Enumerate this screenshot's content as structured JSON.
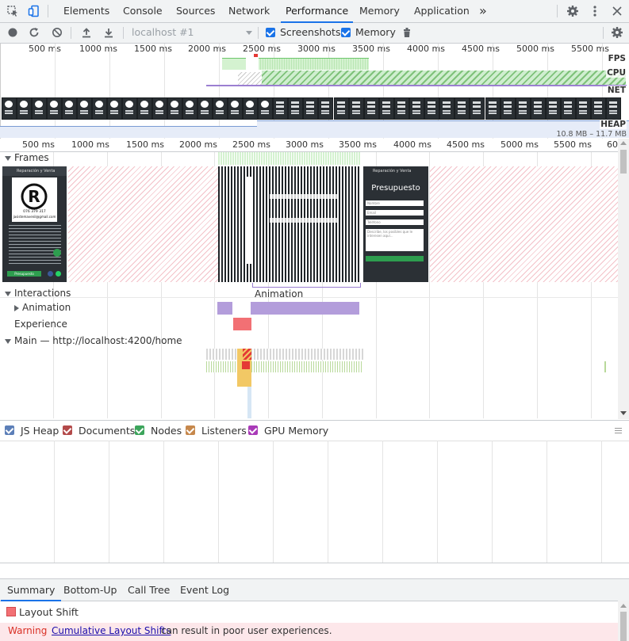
{
  "tabs": [
    {
      "label": "Elements"
    },
    {
      "label": "Console"
    },
    {
      "label": "Sources"
    },
    {
      "label": "Network"
    },
    {
      "label": "Performance"
    },
    {
      "label": "Memory"
    },
    {
      "label": "Application"
    }
  ],
  "more_tabs_glyph": "»",
  "toolbar": {
    "target": "localhost #1",
    "screenshots_label": "Screenshots",
    "memory_label": "Memory"
  },
  "overview": {
    "ticks": [
      "500 ms",
      "1000 ms",
      "1500 ms",
      "2000 ms",
      "2500 ms",
      "3000 ms",
      "3500 ms",
      "4000 ms",
      "4500 ms",
      "5000 ms",
      "5500 ms"
    ],
    "tracks": {
      "fps": "FPS",
      "cpu": "CPU",
      "net": "NET",
      "heap": "HEAP"
    },
    "heap_range": "10.8 MB – 11.7 MB"
  },
  "main_ruler": {
    "ticks": [
      "500 ms",
      "1000 ms",
      "1500 ms",
      "2000 ms",
      "2500 ms",
      "3000 ms",
      "3500 ms",
      "4000 ms",
      "4500 ms",
      "5000 ms",
      "5500 ms",
      "60"
    ]
  },
  "tracks": {
    "frames": "Frames",
    "interactions": "Interactions",
    "animation_row": "Animation",
    "animation_label": "Animation",
    "experience": "Experience",
    "main": "Main — http://localhost:4200/home"
  },
  "screenshot_content": {
    "header_text": "Reparación y Venta",
    "header_text_2": "Reparación y Venta",
    "phone": "076 379 317",
    "email": "jasistemavenil@gmail.com",
    "cta": "Presupuesto",
    "form_title": "Presupuesto",
    "field_name": "Nombre",
    "field_email": "Email",
    "field_phone": "Teléfono",
    "field_message": "Describe, los posibles que le interesen aquí..."
  },
  "memory_legend": [
    {
      "label": "JS Heap",
      "color": "#5c7fb8"
    },
    {
      "label": "Documents",
      "color": "#b34a4a"
    },
    {
      "label": "Nodes",
      "color": "#3ca55c"
    },
    {
      "label": "Listeners",
      "color": "#c6884c"
    },
    {
      "label": "GPU Memory",
      "color": "#a93ab8"
    }
  ],
  "bottom_tabs": [
    {
      "label": "Summary"
    },
    {
      "label": "Bottom-Up"
    },
    {
      "label": "Call Tree"
    },
    {
      "label": "Event Log"
    }
  ],
  "summary": {
    "title": "Layout Shift",
    "warning_label": "Warning",
    "warning_link": "Cumulative Layout Shifts",
    "warning_text": "can result in poor user experiences."
  },
  "colors": {
    "accent": "#1a73e8",
    "fps_green": "#a6e7a0",
    "cpu_hatch": "#8bc98a",
    "interaction_purple": "#b39ddb",
    "experience_red": "#f27074",
    "scripting_yellow": "#f2c865",
    "warning_bg": "#fde7ea",
    "warning_text": "#d93025"
  }
}
